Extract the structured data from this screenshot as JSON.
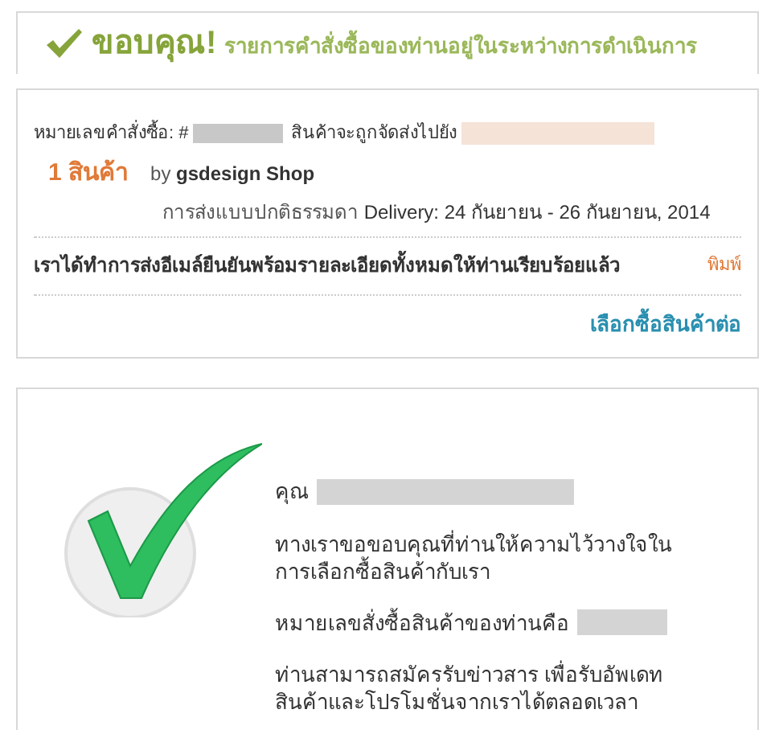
{
  "banner": {
    "title": "ขอบคุณ!",
    "subtitle": "รายการคำสั่งซื้อของท่านอยู่ในระหว่างการดำเนินการ"
  },
  "order": {
    "number_label": "หมายเลขคำสั่งซื้อ: #",
    "ship_to_label": "สินค้าจะถูกจัดส่งไปยัง",
    "item_count": "1 สินค้า",
    "by": "by",
    "shop": "gsdesign Shop",
    "shipping_method": "การส่งแบบปกติธรรมดา",
    "delivery": "Delivery: 24 กันยายน - 26 กันยายน, 2014",
    "email_note": "เราได้ทำการส่งอีเมล์ยืนยันพร้อมรายละเอียดทั้งหมดให้ท่านเรียบร้อยแล้ว",
    "print_link": "พิมพ์",
    "continue_link": "เลือกซื้อสินค้าต่อ"
  },
  "message": {
    "greeting": "คุณ",
    "thanks": "ทางเราขอขอบคุณที่ท่านให้ความไว้วางใจในการเลือกซื้อสินค้ากับเรา",
    "order_number_label": "หมายเลขสั่งซื้อสินค้าของท่านคือ",
    "newsletter": "ท่านสามารถสมัครรับข่าวสาร เพื่อรับอัพเดทสินค้าและโปรโมชั่นจากเราได้ตลอดเวลา"
  }
}
